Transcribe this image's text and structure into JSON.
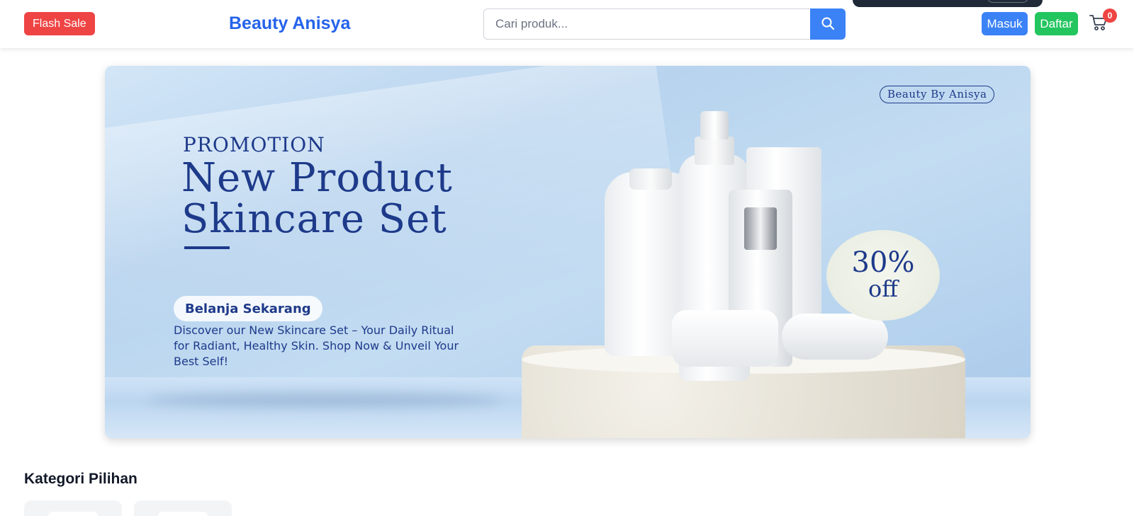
{
  "header": {
    "flash_sale_label": "Flash Sale",
    "brand": "Beauty Anisya",
    "search_placeholder": "Cari produk...",
    "login_label": "Masuk",
    "register_label": "Daftar",
    "cart_count": "0"
  },
  "banner": {
    "brand_tag": "Beauty By Anisya",
    "promo_label": "PROMOTION",
    "headline_line1": "New Product",
    "headline_line2": "Skincare Set",
    "cta_label": "Belanja Sekarang",
    "description": "Discover our New Skincare Set – Your Daily Ritual for Radiant, Healthy Skin. Shop Now & Unveil Your Best Self!",
    "discount_value": "30%",
    "discount_suffix": "off"
  },
  "categories": {
    "title": "Kategori Pilihan"
  },
  "colors": {
    "brand_blue": "#2563eb",
    "flash_red": "#ef4444",
    "login_blue": "#3b82f6",
    "register_green": "#22c55e",
    "banner_navy": "#1e3a8a"
  },
  "icons": {
    "search": "search-icon",
    "cart": "cart-icon"
  }
}
